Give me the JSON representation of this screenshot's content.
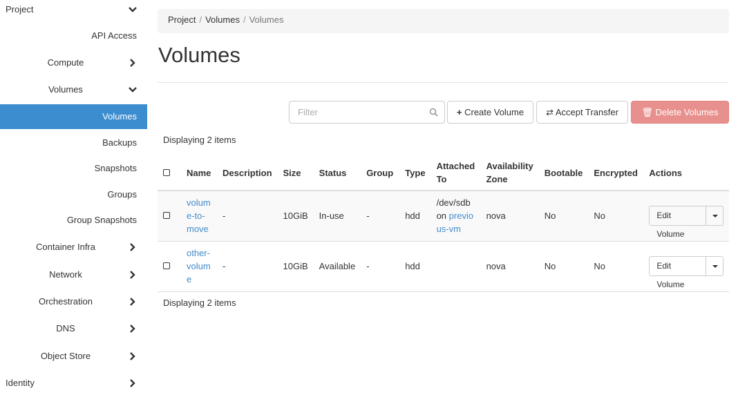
{
  "sidebar": {
    "items": [
      {
        "label": "Project",
        "level": 1,
        "chevron": "down"
      },
      {
        "label": "API Access",
        "level": 3
      },
      {
        "label": "Compute",
        "level": 2,
        "chevron": "right"
      },
      {
        "label": "Volumes",
        "level": 2,
        "chevron": "down"
      },
      {
        "label": "Volumes",
        "level": 3,
        "active": true
      },
      {
        "label": "Backups",
        "level": 3
      },
      {
        "label": "Snapshots",
        "level": 3
      },
      {
        "label": "Groups",
        "level": 3
      },
      {
        "label": "Group Snapshots",
        "level": 3
      },
      {
        "label": "Container Infra",
        "level": 2,
        "chevron": "right"
      },
      {
        "label": "Network",
        "level": 2,
        "chevron": "right"
      },
      {
        "label": "Orchestration",
        "level": 2,
        "chevron": "right"
      },
      {
        "label": "DNS",
        "level": 2,
        "chevron": "right"
      },
      {
        "label": "Object Store",
        "level": 2,
        "chevron": "right"
      },
      {
        "label": "Identity",
        "level": 1,
        "chevron": "right"
      }
    ]
  },
  "breadcrumb": [
    "Project",
    "Volumes",
    "Volumes"
  ],
  "page_title": "Volumes",
  "toolbar": {
    "filter_placeholder": "Filter",
    "create": "Create Volume",
    "accept": "Accept Transfer",
    "delete": "Delete Volumes"
  },
  "display_count": "Displaying 2 items",
  "table": {
    "headers": [
      "Name",
      "Description",
      "Size",
      "Status",
      "Group",
      "Type",
      "Attached To",
      "Availability Zone",
      "Bootable",
      "Encrypted",
      "Actions"
    ],
    "rows": [
      {
        "name": "volume-to-move",
        "description": "-",
        "size": "10GiB",
        "status": "In-use",
        "group": "-",
        "type": "hdd",
        "attached_prefix": "/dev/sdb on ",
        "attached_link": "previous-vm",
        "az": "nova",
        "bootable": "No",
        "encrypted": "No",
        "action": "Edit Volume"
      },
      {
        "name": "other-volume",
        "description": "-",
        "size": "10GiB",
        "status": "Available",
        "group": "-",
        "type": "hdd",
        "attached_prefix": "",
        "attached_link": "",
        "az": "nova",
        "bootable": "No",
        "encrypted": "No",
        "action": "Edit Volume"
      }
    ]
  },
  "colors": {
    "accent": "#3c8dd0",
    "link": "#428bca",
    "danger": "#e8908d"
  }
}
